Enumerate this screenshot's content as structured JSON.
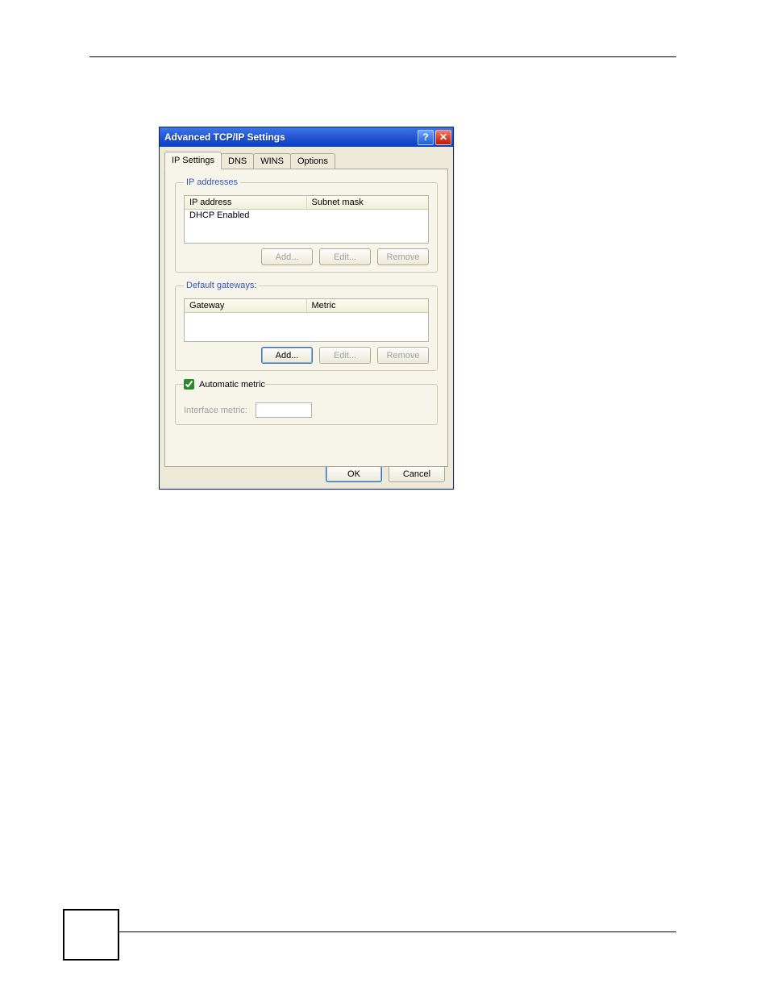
{
  "dialog": {
    "title": "Advanced TCP/IP Settings",
    "tabs": [
      "IP Settings",
      "DNS",
      "WINS",
      "Options"
    ],
    "active_tab": "IP Settings",
    "help_glyph": "?",
    "close_glyph": "✕"
  },
  "ip_group": {
    "legend": "IP addresses",
    "cols": [
      "IP address",
      "Subnet mask"
    ],
    "row0": "DHCP Enabled",
    "add": "Add...",
    "edit": "Edit...",
    "remove": "Remove"
  },
  "gw_group": {
    "legend": "Default gateways:",
    "cols": [
      "Gateway",
      "Metric"
    ],
    "add": "Add...",
    "edit": "Edit...",
    "remove": "Remove"
  },
  "metric": {
    "auto_label": "Automatic metric",
    "auto_checked": true,
    "iface_label": "Interface metric:",
    "iface_value": ""
  },
  "buttons": {
    "ok": "OK",
    "cancel": "Cancel"
  }
}
